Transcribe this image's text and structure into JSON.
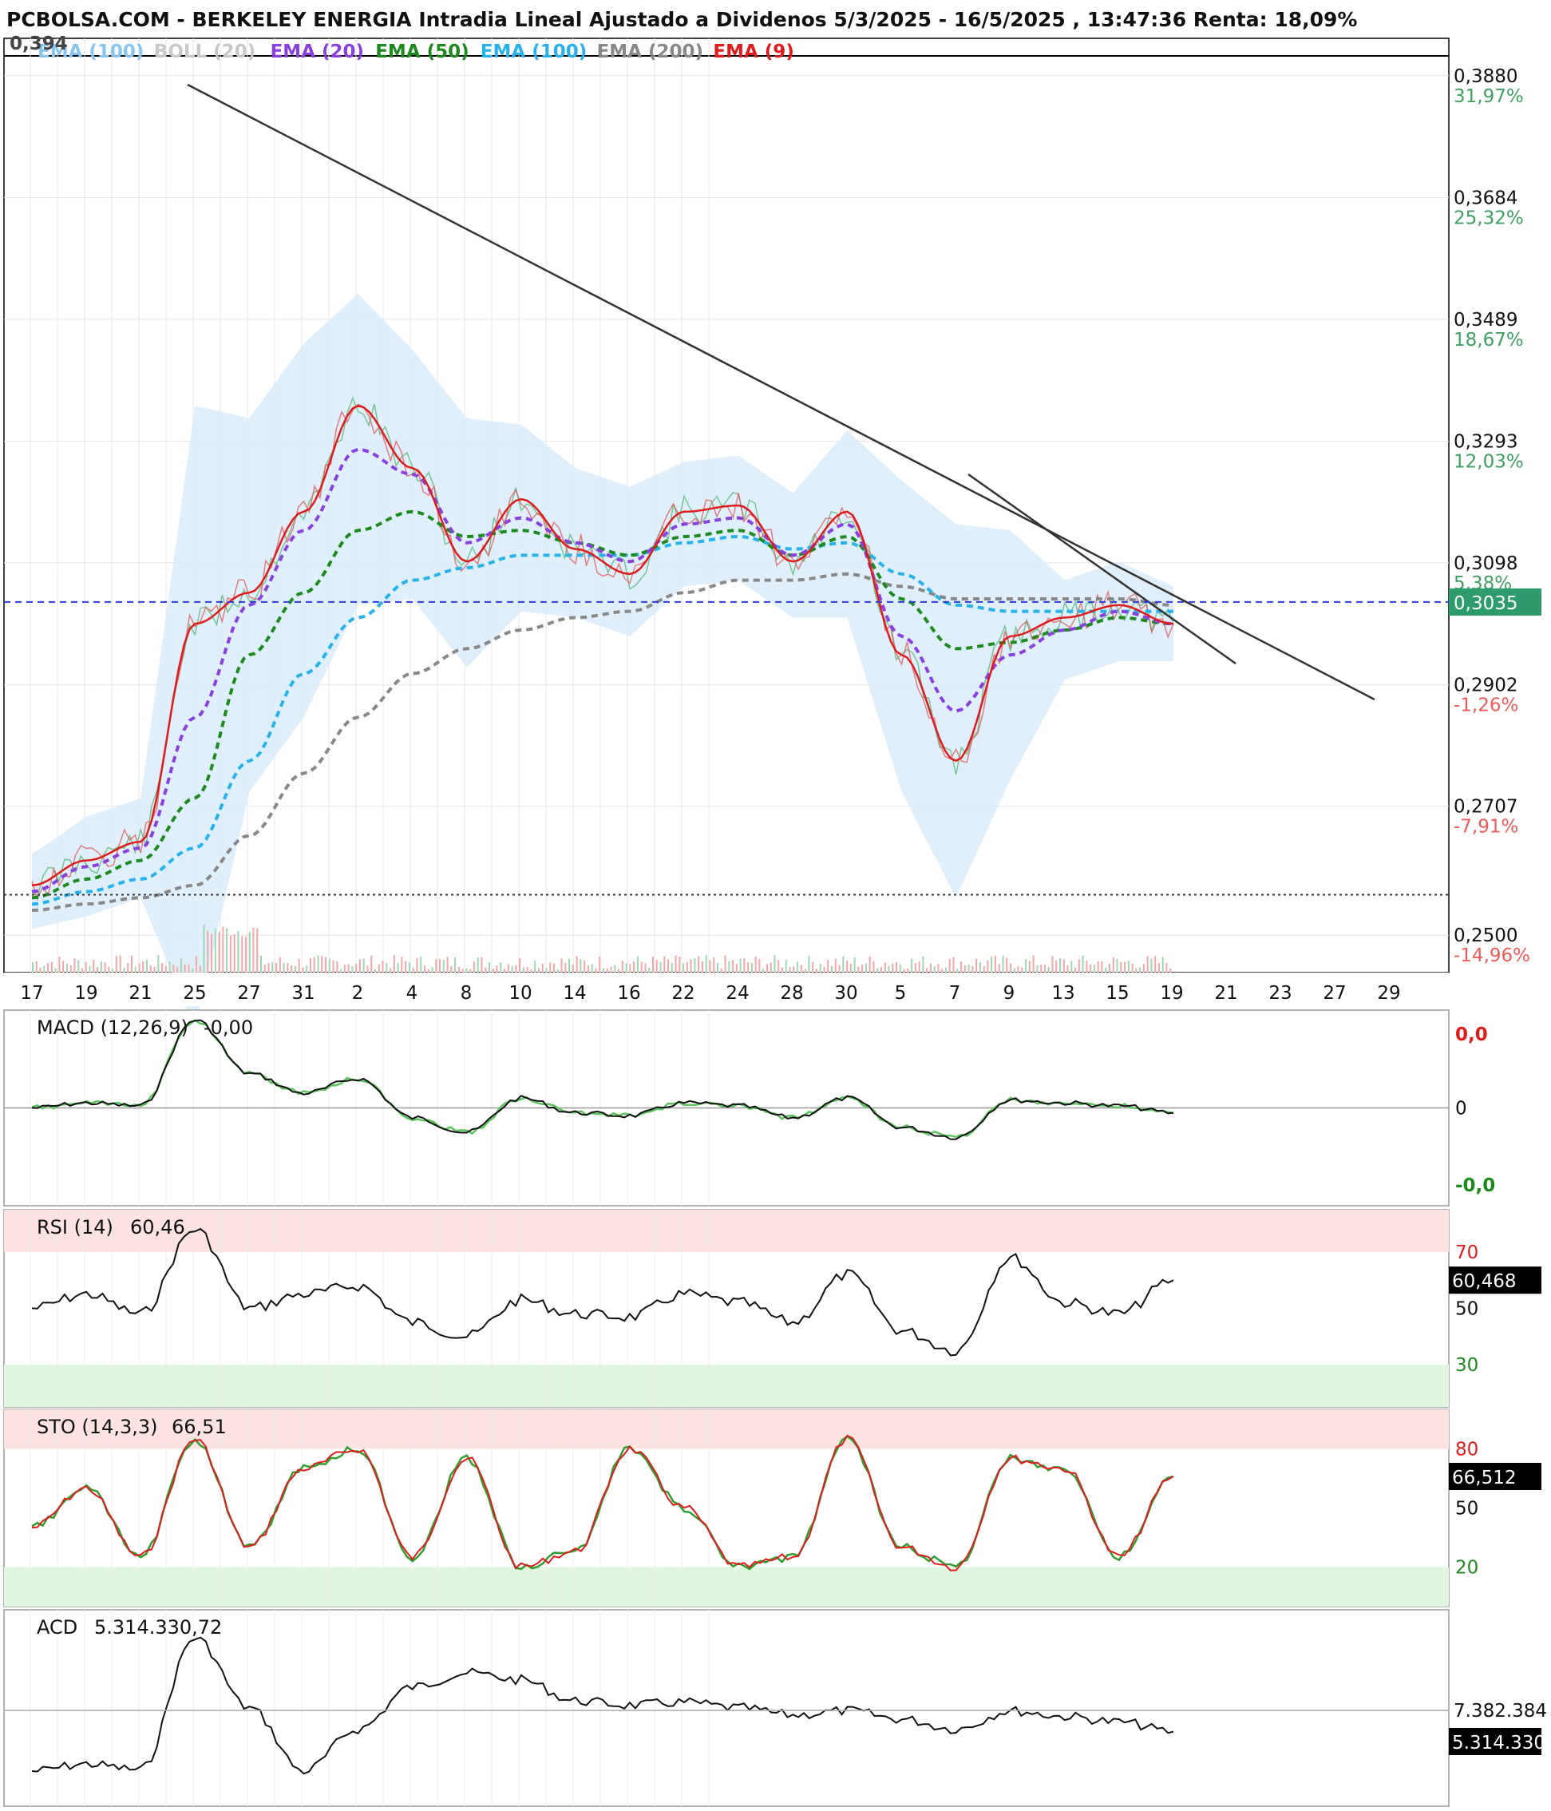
{
  "header": {
    "title": "PCBOLSA.COM - BERKELEY ENERGIA Intradia Lineal Ajustado a Dividenos 5/3/2025 - 16/5/2025 , 13:47:36 Renta: 18,09%",
    "top_value": "0,394"
  },
  "legend": [
    {
      "label": "EMA (100)",
      "color": "#86c5f0"
    },
    {
      "label": "BOLL (20)",
      "color": "#c8c8c8"
    },
    {
      "label": "EMA (20)",
      "color": "#8a3fe0"
    },
    {
      "label": "EMA (50)",
      "color": "#1c8a1c"
    },
    {
      "label": "EMA (100)",
      "color": "#27b2ec"
    },
    {
      "label": "EMA (200)",
      "color": "#888888"
    },
    {
      "label": "EMA (9)",
      "color": "#e01b1b"
    }
  ],
  "price_axis": [
    {
      "price": 0.388,
      "label": "0,3880",
      "pct": "31,97%",
      "sign": "pos"
    },
    {
      "price": 0.3684,
      "label": "0,3684",
      "pct": "25,32%",
      "sign": "pos"
    },
    {
      "price": 0.3489,
      "label": "0,3489",
      "pct": "18,67%",
      "sign": "pos"
    },
    {
      "price": 0.3293,
      "label": "0,3293",
      "pct": "12,03%",
      "sign": "pos"
    },
    {
      "price": 0.3098,
      "label": "0,3098",
      "pct": "5,38%",
      "sign": "pos"
    },
    {
      "price": 0.2902,
      "label": "0,2902",
      "pct": "-1,26%",
      "sign": "neg"
    },
    {
      "price": 0.2707,
      "label": "0,2707",
      "pct": "-7,91%",
      "sign": "neg"
    },
    {
      "price": 0.25,
      "label": "0,2500",
      "pct": "-14,96%",
      "sign": "neg"
    }
  ],
  "current_price": {
    "price": 0.3035,
    "label": "0,3035",
    "color": "#2e9b6b"
  },
  "x_axis_labels": [
    "17",
    "19",
    "21",
    "25",
    "27",
    "31",
    "2",
    "4",
    "8",
    "10",
    "14",
    "16",
    "22",
    "24",
    "28",
    "30",
    "5",
    "7",
    "9",
    "13",
    "15",
    "19",
    "21",
    "23",
    "27",
    "29"
  ],
  "chart_data": [
    {
      "type": "line",
      "title": "PCBOLSA.COM - BERKELEY ENERGIA Intradia Lineal Ajustado a Dividenos 5/3/2025 - 16/5/2025 , 13:47:36 Renta: 18,09%",
      "x": [
        "17",
        "19",
        "21",
        "25",
        "27",
        "31",
        "2",
        "4",
        "8",
        "10",
        "14",
        "16",
        "22",
        "24",
        "28",
        "30",
        "5",
        "7",
        "9",
        "13",
        "15",
        "19"
      ],
      "ylim": [
        0.244,
        0.394
      ],
      "series": [
        {
          "name": "EMA (9)",
          "values": [
            0.258,
            0.262,
            0.265,
            0.3,
            0.305,
            0.318,
            0.335,
            0.325,
            0.31,
            0.32,
            0.312,
            0.308,
            0.318,
            0.319,
            0.31,
            0.318,
            0.295,
            0.278,
            0.298,
            0.301,
            0.303,
            0.3
          ]
        },
        {
          "name": "EMA (20)",
          "values": [
            0.257,
            0.261,
            0.264,
            0.285,
            0.303,
            0.315,
            0.328,
            0.324,
            0.313,
            0.317,
            0.313,
            0.31,
            0.316,
            0.317,
            0.311,
            0.316,
            0.298,
            0.286,
            0.295,
            0.299,
            0.302,
            0.3
          ]
        },
        {
          "name": "EMA (50)",
          "values": [
            0.256,
            0.259,
            0.262,
            0.272,
            0.295,
            0.305,
            0.315,
            0.318,
            0.314,
            0.315,
            0.313,
            0.311,
            0.314,
            0.315,
            0.311,
            0.314,
            0.304,
            0.296,
            0.297,
            0.299,
            0.301,
            0.3
          ]
        },
        {
          "name": "EMA (100)",
          "values": [
            0.255,
            0.257,
            0.259,
            0.264,
            0.278,
            0.292,
            0.301,
            0.307,
            0.309,
            0.311,
            0.311,
            0.311,
            0.313,
            0.314,
            0.312,
            0.313,
            0.308,
            0.303,
            0.302,
            0.302,
            0.302,
            0.302
          ]
        },
        {
          "name": "EMA (200)",
          "values": [
            0.254,
            0.255,
            0.256,
            0.258,
            0.266,
            0.276,
            0.285,
            0.292,
            0.296,
            0.299,
            0.301,
            0.302,
            0.305,
            0.307,
            0.307,
            0.308,
            0.306,
            0.304,
            0.304,
            0.304,
            0.304,
            0.303
          ]
        }
      ]
    },
    {
      "type": "line",
      "title": "MACD (12,26,9)",
      "value_label": "-0,00",
      "axis_labels": [
        "0,0",
        "0",
        "-0,0"
      ],
      "x": [
        "17",
        "19",
        "21",
        "25",
        "27",
        "31",
        "2",
        "4",
        "8",
        "10",
        "14",
        "16",
        "22",
        "24",
        "28",
        "30",
        "5",
        "7",
        "9",
        "13",
        "15",
        "19"
      ],
      "ylim": [
        -1,
        1
      ],
      "series": [
        {
          "name": "MACD",
          "values": [
            0,
            0.05,
            0.02,
            0.9,
            0.35,
            0.15,
            0.3,
            -0.1,
            -0.25,
            0.1,
            -0.05,
            -0.08,
            0.05,
            0.02,
            -0.1,
            0.1,
            -0.2,
            -0.3,
            0.08,
            0.05,
            0.02,
            -0.05
          ]
        }
      ]
    },
    {
      "type": "line",
      "title": "RSI (14)",
      "value_label": "60,46",
      "current_label": "60,468",
      "levels": [
        70,
        50,
        30
      ],
      "x": [
        "17",
        "19",
        "21",
        "25",
        "27",
        "31",
        "2",
        "4",
        "8",
        "10",
        "14",
        "16",
        "22",
        "24",
        "28",
        "30",
        "5",
        "7",
        "9",
        "13",
        "15",
        "19"
      ],
      "ylim": [
        15,
        85
      ],
      "series": [
        {
          "name": "RSI",
          "values": [
            50,
            55,
            48,
            78,
            50,
            55,
            58,
            45,
            40,
            53,
            48,
            47,
            55,
            52,
            45,
            62,
            42,
            35,
            68,
            52,
            48,
            60
          ]
        }
      ]
    },
    {
      "type": "line",
      "title": "STO (14,3,3)",
      "value_label": "66,51",
      "current_label": "66,512",
      "levels": [
        80,
        50,
        20
      ],
      "x": [
        "17",
        "19",
        "21",
        "25",
        "27",
        "31",
        "2",
        "4",
        "8",
        "10",
        "14",
        "16",
        "22",
        "24",
        "28",
        "30",
        "5",
        "7",
        "9",
        "13",
        "15",
        "19"
      ],
      "ylim": [
        0,
        100
      ],
      "series": [
        {
          "name": "%K",
          "values": [
            40,
            60,
            25,
            85,
            30,
            70,
            80,
            25,
            75,
            20,
            28,
            80,
            50,
            20,
            25,
            85,
            30,
            20,
            75,
            70,
            25,
            66
          ]
        }
      ]
    },
    {
      "type": "line",
      "title": "ACD",
      "value_label": "5.314.330,72",
      "current_label": "5.314.330",
      "mid_label": "7.382.384",
      "x": [
        "17",
        "19",
        "21",
        "25",
        "27",
        "31",
        "2",
        "4",
        "8",
        "10",
        "14",
        "16",
        "22",
        "24",
        "28",
        "30",
        "5",
        "7",
        "9",
        "13",
        "15",
        "19"
      ],
      "ylim": [
        0,
        14000000
      ],
      "series": [
        {
          "name": "ACD",
          "values": [
            2500000,
            3000000,
            2600000,
            12000000,
            7000000,
            2500000,
            5500000,
            8500000,
            9500000,
            9000000,
            7500000,
            7200000,
            7400000,
            7000000,
            6500000,
            6800000,
            6200000,
            5500000,
            6800000,
            6400000,
            6000000,
            5314330
          ]
        }
      ]
    }
  ]
}
